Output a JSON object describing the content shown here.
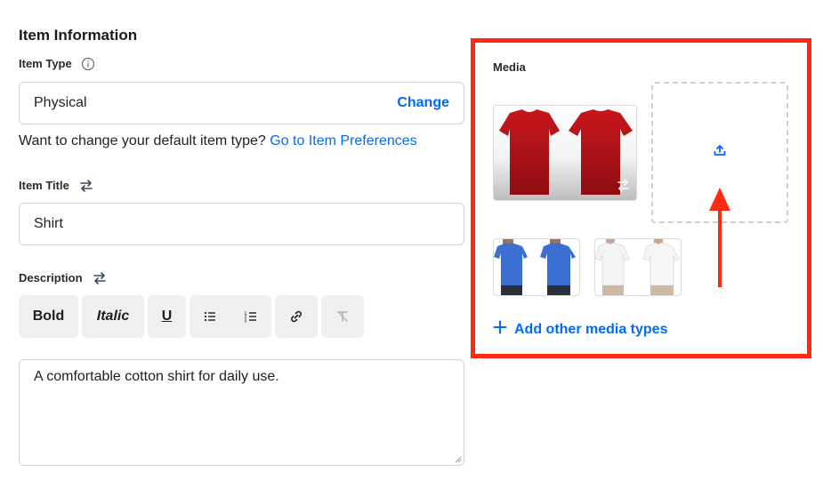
{
  "section": {
    "title": "Item Information"
  },
  "item_type": {
    "label": "Item Type",
    "value": "Physical",
    "change_label": "Change",
    "helper_text": "Want to change your default item type?",
    "helper_link": "Go to Item Preferences"
  },
  "item_title": {
    "label": "Item Title",
    "value": "Shirt"
  },
  "description": {
    "label": "Description",
    "toolbar": {
      "bold": "Bold",
      "italic": "Italic",
      "underline": "U"
    },
    "value": "A comfortable cotton shirt for daily use."
  },
  "media": {
    "label": "Media",
    "add_other_label": "Add other media types",
    "images": [
      "red-tshirts",
      "blue-tshirts",
      "white-tshirts"
    ]
  },
  "colors": {
    "accent": "#006aff",
    "highlight_border": "#ff2a12",
    "arrow": "#ff2a12"
  },
  "icons": [
    "info-icon",
    "swap-icon",
    "bullet-list-icon",
    "numbered-list-icon",
    "link-icon",
    "clear-format-icon",
    "upload-icon",
    "plus-icon"
  ]
}
